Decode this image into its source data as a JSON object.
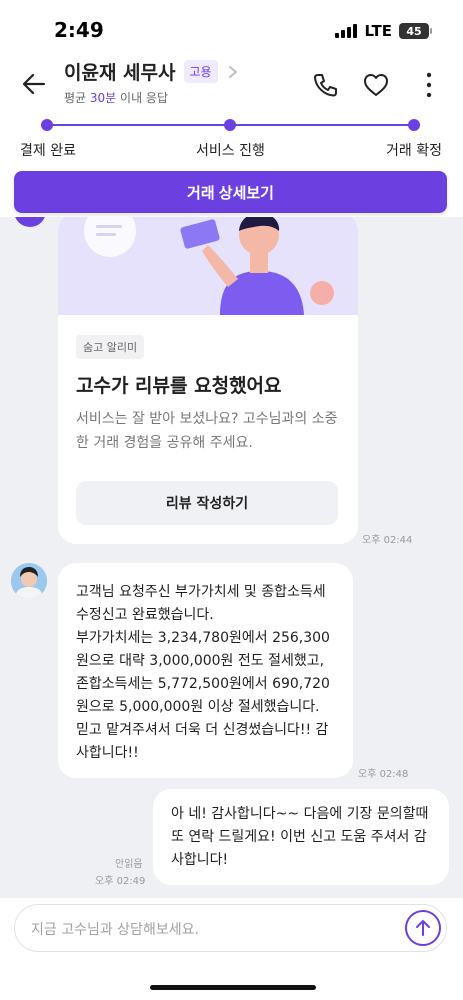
{
  "status_bar": {
    "time": "2:49",
    "network": "LTE",
    "battery": "45"
  },
  "header": {
    "expert_name": "이윤재 세무사",
    "badge": "고용",
    "response_prefix": "평균 ",
    "response_time": "30분",
    "response_suffix": " 이내 응답",
    "icons": [
      "back-arrow-icon",
      "chevron-right-icon",
      "phone-icon",
      "heart-icon",
      "more-vertical-icon"
    ]
  },
  "progress": {
    "steps": [
      "결제 완료",
      "서비스 진행",
      "거래 확정"
    ]
  },
  "detail_button": "거래 상세보기",
  "review_card": {
    "tag": "숨고 알리미",
    "title": "고수가 리뷰를 요청했어요",
    "body": "서비스는 잘 받아 보셨나요? 고수님과의 소중한 거래 경험을 공유해 주세요.",
    "button": "리뷰 작성하기",
    "time": "오후 02:44"
  },
  "messages": {
    "incoming_text": "고객님 요청주신 부가가치세 및 종합소득세\n수정신고 완료했습니다.\n부가가치세는 3,234,780원에서 256,300\n원으로 대략 3,000,000원 전도 절세했고,\n존합소득세는 5,772,500원에서 690,720\n원으로 5,000,000원 이상 절세했습니다.\n믿고 맡겨주셔서 더욱 더 신경썼습니다!! 감\n사합니다!!",
    "incoming_time": "오후 02:48",
    "outgoing_text": "아 네! 감사합니다~~ 다음에 기장 문의할때\n또 연락 드릴게요! 이번 신고 도움 주셔서 감\n사합니다!",
    "outgoing_read": "안읽음",
    "outgoing_time": "오후 02:49"
  },
  "input": {
    "placeholder": "지금 고수님과 상담해보세요."
  },
  "colors": {
    "accent": "#6b3fe0",
    "chat_bg": "#eff0f3"
  }
}
